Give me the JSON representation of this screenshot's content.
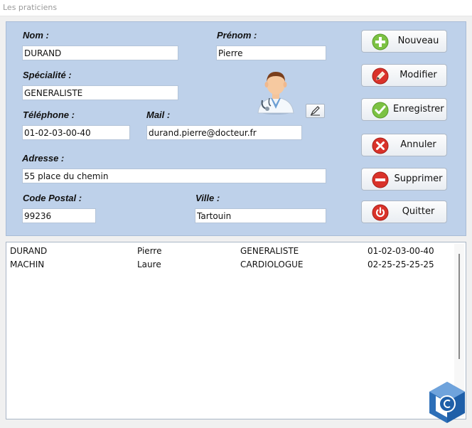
{
  "window": {
    "title": "Les praticiens"
  },
  "form": {
    "nom": {
      "label": "Nom :",
      "value": "DURAND"
    },
    "prenom": {
      "label": "Prénom :",
      "value": "Pierre"
    },
    "specialite": {
      "label": "Spécialité :",
      "value": "GENERALISTE"
    },
    "telephone": {
      "label": "Téléphone :",
      "value": "01-02-03-00-40"
    },
    "mail": {
      "label": "Mail :",
      "value": "durand.pierre@docteur.fr"
    },
    "adresse": {
      "label": "Adresse :",
      "value": "55 place du chemin"
    },
    "code_postal": {
      "label": "Code Postal :",
      "value": "99236"
    },
    "ville": {
      "label": "Ville :",
      "value": "Tartouin"
    }
  },
  "buttons": {
    "nouveau": {
      "label": "Nouveau",
      "icon": "plus-icon",
      "color": "#7cc243"
    },
    "modifier": {
      "label": "Modifier",
      "icon": "pencil-icon",
      "color": "#d9322a"
    },
    "enregistrer": {
      "label": "Enregistrer",
      "icon": "check-icon",
      "color": "#7cc243"
    },
    "annuler": {
      "label": "Annuler",
      "icon": "cross-icon",
      "color": "#d9322a"
    },
    "supprimer": {
      "label": "Supprimer",
      "icon": "minus-icon",
      "color": "#d9322a"
    },
    "quitter": {
      "label": "Quitter",
      "icon": "power-icon",
      "color": "#d9322a"
    }
  },
  "list": {
    "rows": [
      {
        "nom": "DURAND",
        "prenom": "Pierre",
        "specialite": "GENERALISTE",
        "telephone": "01-02-03-00-40"
      },
      {
        "nom": "MACHIN",
        "prenom": "Laure",
        "specialite": "CARDIOLOGUE",
        "telephone": "02-25-25-25-25"
      }
    ]
  },
  "icons": {
    "avatar": "doctor-avatar-icon",
    "mail_edit": "edit-icon",
    "logo": "copyright-logo-icon"
  },
  "colors": {
    "panel_bg": "#bed1ea",
    "window_bg": "#f0f0f0"
  }
}
